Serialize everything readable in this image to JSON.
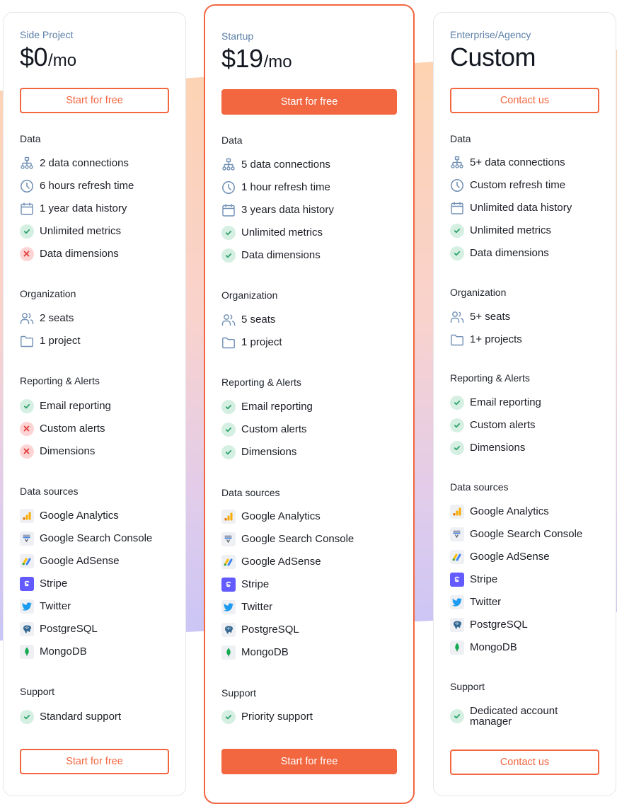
{
  "accent_color": "#f26640",
  "plans": [
    {
      "name": "Side Project",
      "price": "$0",
      "price_unit": "/mo",
      "featured": false,
      "cta_top": "Start for free",
      "cta_bottom": "Start for free",
      "sections": {
        "data": {
          "title": "Data",
          "items": [
            {
              "icon": "sitemap-icon",
              "label": "2 data connections"
            },
            {
              "icon": "clock-icon",
              "label": "6 hours refresh time"
            },
            {
              "icon": "calendar-icon",
              "label": "1 year data history"
            },
            {
              "icon": "check-icon",
              "label": "Unlimited metrics"
            },
            {
              "icon": "x-icon",
              "label": "Data dimensions"
            }
          ]
        },
        "organization": {
          "title": "Organization",
          "items": [
            {
              "icon": "users-icon",
              "label": "2 seats"
            },
            {
              "icon": "folder-icon",
              "label": "1 project"
            }
          ]
        },
        "reporting": {
          "title": "Reporting & Alerts",
          "items": [
            {
              "icon": "check-icon",
              "label": "Email reporting"
            },
            {
              "icon": "x-icon",
              "label": "Custom alerts"
            },
            {
              "icon": "x-icon",
              "label": "Dimensions"
            }
          ]
        },
        "sources": {
          "title": "Data sources",
          "items": [
            {
              "icon": "google-analytics-icon",
              "label": "Google Analytics"
            },
            {
              "icon": "google-search-console-icon",
              "label": "Google Search Console"
            },
            {
              "icon": "google-adsense-icon",
              "label": "Google AdSense"
            },
            {
              "icon": "stripe-icon",
              "label": "Stripe"
            },
            {
              "icon": "twitter-icon",
              "label": "Twitter"
            },
            {
              "icon": "postgresql-icon",
              "label": "PostgreSQL"
            },
            {
              "icon": "mongodb-icon",
              "label": "MongoDB"
            }
          ]
        },
        "support": {
          "title": "Support",
          "items": [
            {
              "icon": "check-icon",
              "label": "Standard support"
            }
          ]
        }
      }
    },
    {
      "name": "Startup",
      "price": "$19",
      "price_unit": "/mo",
      "featured": true,
      "cta_top": "Start for free",
      "cta_bottom": "Start for free",
      "sections": {
        "data": {
          "title": "Data",
          "items": [
            {
              "icon": "sitemap-icon",
              "label": "5 data connections"
            },
            {
              "icon": "clock-icon",
              "label": "1 hour refresh time"
            },
            {
              "icon": "calendar-icon",
              "label": "3 years data history"
            },
            {
              "icon": "check-icon",
              "label": "Unlimited metrics"
            },
            {
              "icon": "check-icon",
              "label": "Data dimensions"
            }
          ]
        },
        "organization": {
          "title": "Organization",
          "items": [
            {
              "icon": "users-icon",
              "label": "5 seats"
            },
            {
              "icon": "folder-icon",
              "label": "1 project"
            }
          ]
        },
        "reporting": {
          "title": "Reporting & Alerts",
          "items": [
            {
              "icon": "check-icon",
              "label": "Email reporting"
            },
            {
              "icon": "check-icon",
              "label": "Custom alerts"
            },
            {
              "icon": "check-icon",
              "label": "Dimensions"
            }
          ]
        },
        "sources": {
          "title": "Data sources",
          "items": [
            {
              "icon": "google-analytics-icon",
              "label": "Google Analytics"
            },
            {
              "icon": "google-search-console-icon",
              "label": "Google Search Console"
            },
            {
              "icon": "google-adsense-icon",
              "label": "Google AdSense"
            },
            {
              "icon": "stripe-icon",
              "label": "Stripe"
            },
            {
              "icon": "twitter-icon",
              "label": "Twitter"
            },
            {
              "icon": "postgresql-icon",
              "label": "PostgreSQL"
            },
            {
              "icon": "mongodb-icon",
              "label": "MongoDB"
            }
          ]
        },
        "support": {
          "title": "Support",
          "items": [
            {
              "icon": "check-icon",
              "label": "Priority support"
            }
          ]
        }
      }
    },
    {
      "name": "Enterprise/Agency",
      "price": "Custom",
      "price_unit": "",
      "featured": false,
      "cta_top": "Contact us",
      "cta_bottom": "Contact us",
      "sections": {
        "data": {
          "title": "Data",
          "items": [
            {
              "icon": "sitemap-icon",
              "label": "5+ data connections"
            },
            {
              "icon": "clock-icon",
              "label": "Custom refresh time"
            },
            {
              "icon": "calendar-icon",
              "label": "Unlimited data history"
            },
            {
              "icon": "check-icon",
              "label": "Unlimited metrics"
            },
            {
              "icon": "check-icon",
              "label": "Data dimensions"
            }
          ]
        },
        "organization": {
          "title": "Organization",
          "items": [
            {
              "icon": "users-icon",
              "label": "5+ seats"
            },
            {
              "icon": "folder-icon",
              "label": "1+ projects"
            }
          ]
        },
        "reporting": {
          "title": "Reporting & Alerts",
          "items": [
            {
              "icon": "check-icon",
              "label": "Email reporting"
            },
            {
              "icon": "check-icon",
              "label": "Custom alerts"
            },
            {
              "icon": "check-icon",
              "label": "Dimensions"
            }
          ]
        },
        "sources": {
          "title": "Data sources",
          "items": [
            {
              "icon": "google-analytics-icon",
              "label": "Google Analytics"
            },
            {
              "icon": "google-search-console-icon",
              "label": "Google Search Console"
            },
            {
              "icon": "google-adsense-icon",
              "label": "Google AdSense"
            },
            {
              "icon": "stripe-icon",
              "label": "Stripe"
            },
            {
              "icon": "twitter-icon",
              "label": "Twitter"
            },
            {
              "icon": "postgresql-icon",
              "label": "PostgreSQL"
            },
            {
              "icon": "mongodb-icon",
              "label": "MongoDB"
            }
          ]
        },
        "support": {
          "title": "Support",
          "items": [
            {
              "icon": "check-icon",
              "label": "Dedicated account manager"
            }
          ]
        }
      }
    }
  ]
}
